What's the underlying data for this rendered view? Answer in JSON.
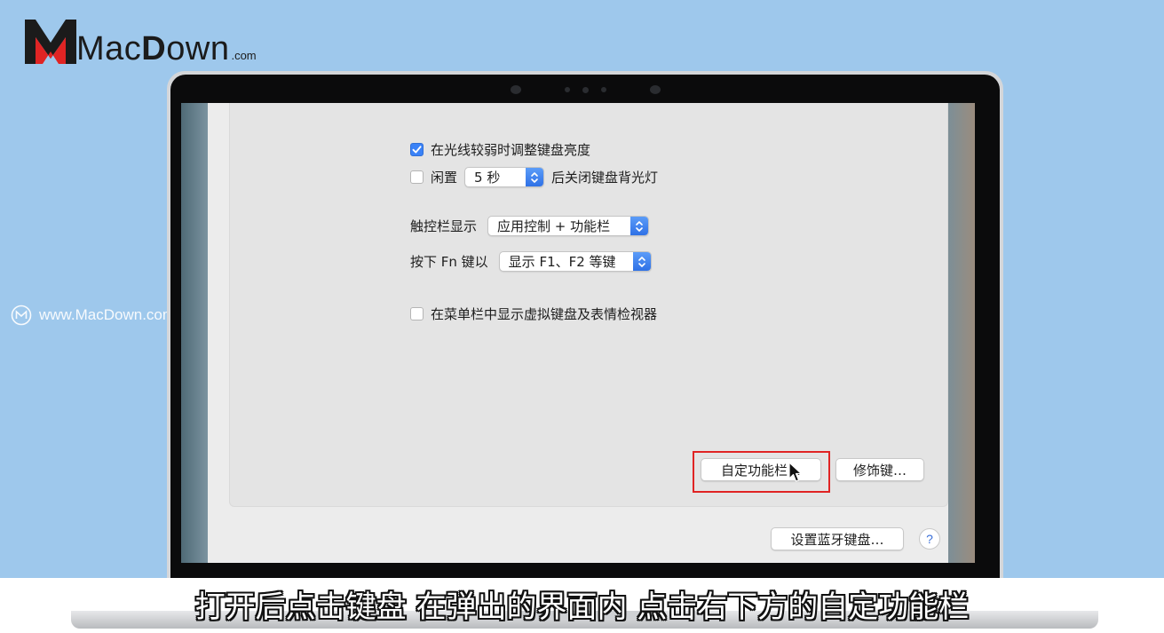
{
  "branding": {
    "logo_text_pre": "Mac",
    "logo_text_d": "D",
    "logo_text_post": "own",
    "logo_com": ".com",
    "watermark": "www.MacDown.com"
  },
  "keyboard_prefs": {
    "adjust_brightness": {
      "label": "在光线较弱时调整键盘亮度",
      "checked": true
    },
    "backlight_off": {
      "checked": false,
      "prefix": "闲置",
      "value": "5 秒",
      "suffix": "后关闭键盘背光灯"
    },
    "touchbar_shows": {
      "label": "触控栏显示",
      "value": "应用控制 + 功能栏"
    },
    "press_fn": {
      "label": "按下 Fn 键以",
      "value": "显示 F1、F2 等键"
    },
    "show_viewer": {
      "label": "在菜单栏中显示虚拟键盘及表情检视器",
      "checked": false
    },
    "customize_button": "自定功能栏…",
    "modifier_button": "修饰键…",
    "bluetooth_button": "设置蓝牙键盘…",
    "help_label": "?"
  },
  "subtitle": "打开后点击键盘 在弹出的界面内 点击右下方的自定功能栏",
  "colors": {
    "accent": "#3a82f7",
    "highlight": "#e02424",
    "background": "#9ec8ec"
  }
}
